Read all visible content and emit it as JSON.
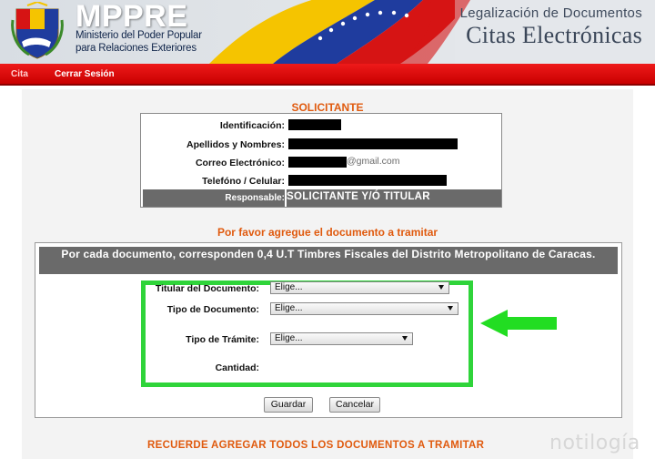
{
  "header": {
    "brand_name": "MPPRE",
    "brand_sub_1": "Ministerio del Poder Popular",
    "brand_sub_2": "para Relaciones Exteriores",
    "title_1": "Legalización de Documentos",
    "title_2": "Citas Electrónicas"
  },
  "nav": {
    "items": [
      {
        "label": "Cita"
      },
      {
        "label": "Cerrar Sesión"
      }
    ]
  },
  "applicant": {
    "section_title": "SOLICITANTE",
    "fields": [
      {
        "label": "Identificación:"
      },
      {
        "label": "Apellidos y Nombres:"
      },
      {
        "label": "Correo Electrónico:",
        "visible_suffix": "@gmail.com"
      },
      {
        "label": "Telefóno / Celular:"
      }
    ],
    "responsible_label": "Responsable:",
    "responsible_value": "SOLICITANTE Y/Ó TITULAR"
  },
  "documents": {
    "section_title": "Por favor agregue el documento a tramitar",
    "notice": "Por cada documento, corresponden 0,4 U.T Timbres Fiscales del Distrito Metropolitano de Caracas.",
    "fields": [
      {
        "label": "Titular del Documento:",
        "value": "Elige..."
      },
      {
        "label": "Tipo de Documento:",
        "value": "Elige..."
      },
      {
        "label": "Tipo de Trámite:",
        "value": "Elige..."
      },
      {
        "label": "Cantidad:"
      }
    ],
    "save_label": "Guardar",
    "cancel_label": "Cancelar"
  },
  "footer": {
    "reminder": "RECUERDE AGREGAR TODOS LOS DOCUMENTOS A TRAMITAR",
    "watermark": "notilogía"
  },
  "colors": {
    "nav_red": "#d50000",
    "accent_orange": "#e05a0e",
    "highlight_green": "#2fd43a",
    "panel_gray": "#6a6a6a"
  },
  "icons": {
    "crest": "venezuela-coat-of-arms-icon",
    "flag": "venezuela-flag-graphic",
    "arrow": "green-left-arrow-icon"
  }
}
